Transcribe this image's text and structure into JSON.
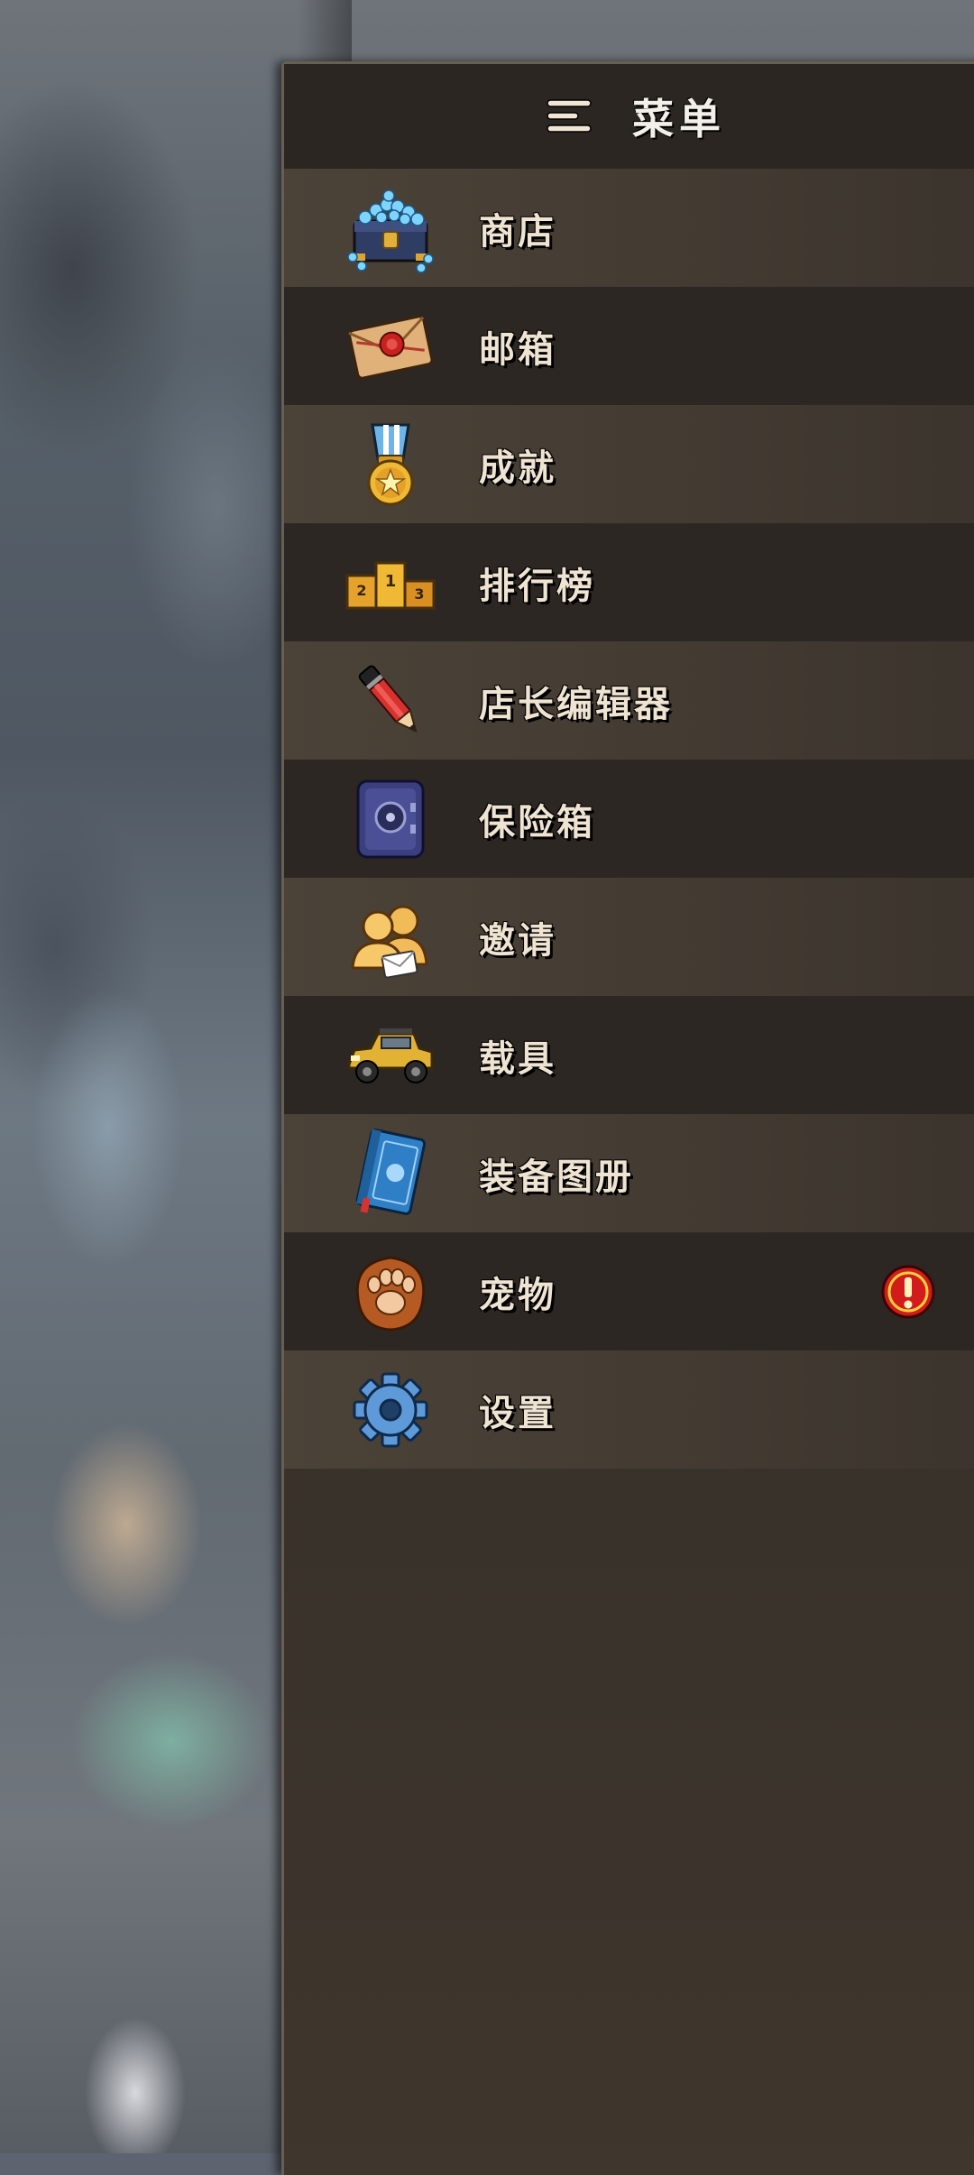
{
  "menu": {
    "title": "菜单",
    "items": [
      {
        "label": "商店",
        "icon": "gem-chest-icon"
      },
      {
        "label": "邮箱",
        "icon": "sealed-envelope-icon"
      },
      {
        "label": "成就",
        "icon": "star-medal-icon"
      },
      {
        "label": "排行榜",
        "icon": "podium-icon"
      },
      {
        "label": "店长编辑器",
        "icon": "pencil-icon"
      },
      {
        "label": "保险箱",
        "icon": "safe-icon"
      },
      {
        "label": "邀请",
        "icon": "invite-friends-icon"
      },
      {
        "label": "载具",
        "icon": "jeep-icon"
      },
      {
        "label": "装备图册",
        "icon": "blue-book-icon"
      },
      {
        "label": "宠物",
        "icon": "paw-icon",
        "badge": "alert"
      },
      {
        "label": "设置",
        "icon": "gear-icon"
      }
    ]
  },
  "colors": {
    "panel_bg": "#35302a",
    "row_light": "#463e35",
    "row_dark": "#2d2723",
    "label_text": "#efe3d1",
    "alert_red": "#d21c1c"
  }
}
